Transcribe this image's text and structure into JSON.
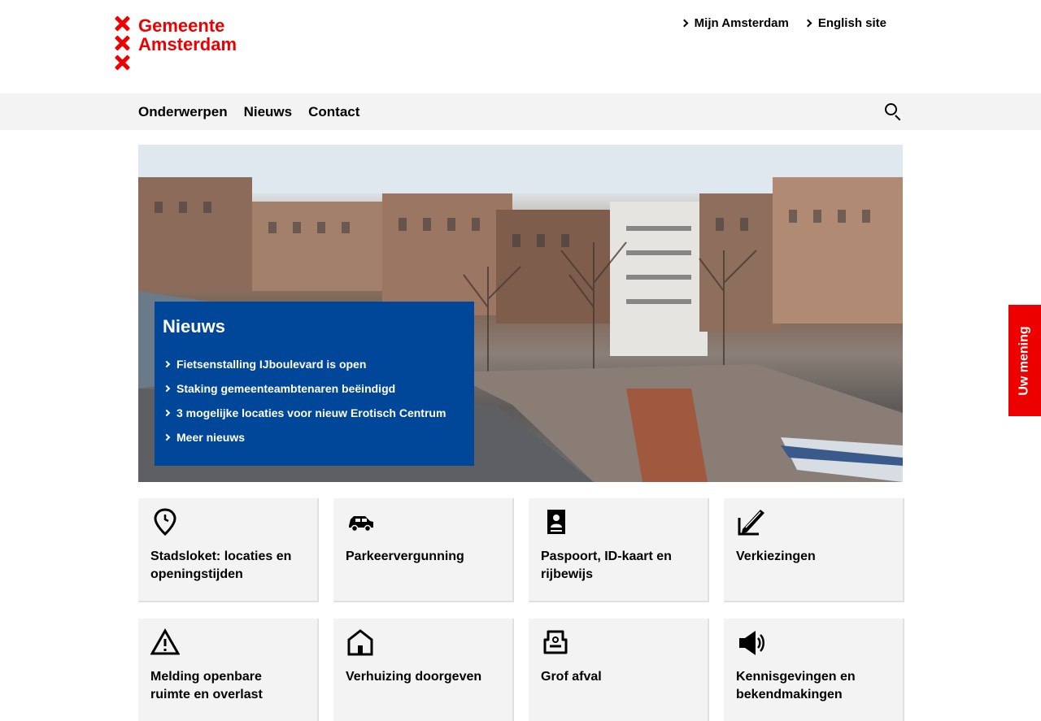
{
  "header": {
    "logo_line1": "Gemeente",
    "logo_line2": "Amsterdam",
    "top_links": [
      "Mijn Amsterdam",
      "English site"
    ]
  },
  "nav": {
    "items": [
      "Onderwerpen",
      "Nieuws",
      "Contact"
    ],
    "search_icon": "search-icon"
  },
  "news": {
    "title": "Nieuws",
    "items": [
      "Fietsenstalling IJboulevard is open",
      "Staking gemeenteambtenaren beëindigd",
      "3 mogelijke locaties voor nieuw Erotisch Centrum",
      "Meer nieuws"
    ]
  },
  "side_tab": {
    "label": "Uw mening"
  },
  "tiles": [
    {
      "label": "Stadsloket: locaties en openingstijden",
      "icon": "location-clock-icon"
    },
    {
      "label": "Parkeervergunning",
      "icon": "car-icon"
    },
    {
      "label": "Paspoort, ID-kaart en rijbewijs",
      "icon": "passport-icon"
    },
    {
      "label": "Verkiezingen",
      "icon": "ballot-pencil-icon"
    },
    {
      "label": "Melding openbare ruimte en overlast",
      "icon": "warning-icon"
    },
    {
      "label": "Verhuizing doorgeven",
      "icon": "house-icon"
    },
    {
      "label": "Grof afval",
      "icon": "armchair-icon"
    },
    {
      "label": "Kennisgevingen en bekendmakingen",
      "icon": "megaphone-icon"
    }
  ],
  "colors": {
    "brand_red": "#ec0000",
    "news_blue": "#004699",
    "nav_bg": "#f3f3f3"
  }
}
